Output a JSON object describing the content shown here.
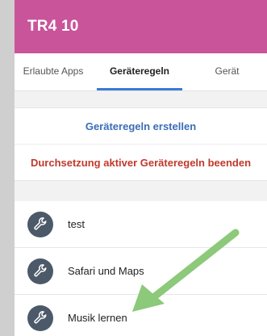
{
  "header": {
    "title": "TR4 10"
  },
  "tabs": [
    {
      "label": "Erlaubte Apps"
    },
    {
      "label": "Geräteregeln"
    },
    {
      "label": "Gerät"
    }
  ],
  "actions": {
    "create_label": "Geräteregeln erstellen",
    "stop_label": "Durchsetzung aktiver Geräteregeln beenden"
  },
  "rules": [
    {
      "label": "test",
      "icon": "wrench-icon"
    },
    {
      "label": "Safari und Maps",
      "icon": "wrench-icon"
    },
    {
      "label": "Musik lernen",
      "icon": "wrench-icon"
    }
  ],
  "colors": {
    "appbar": "#c9549a",
    "tab_indicator": "#3a7bd5",
    "create_text": "#3a6db6",
    "stop_text": "#c0392b",
    "avatar": "#4c5968",
    "arrow": "#8cc97a"
  }
}
